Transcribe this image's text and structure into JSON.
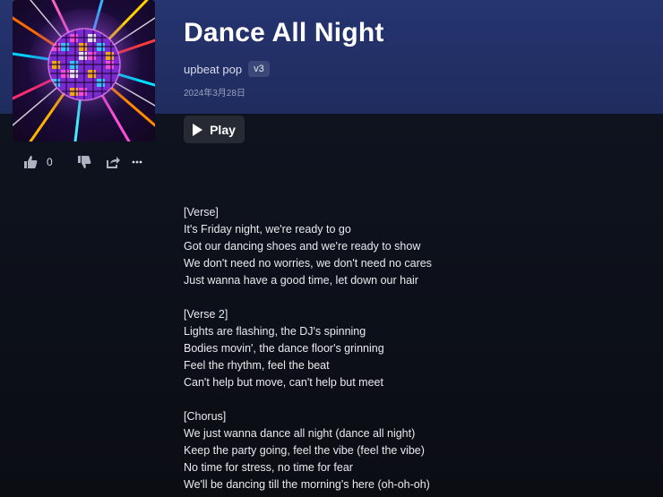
{
  "song": {
    "title": "Dance All Night",
    "tags": "upbeat pop",
    "version": "v3",
    "date": "2024年3月28日",
    "cover_icon": "disco-ball-icon"
  },
  "actions": {
    "like_count": "0",
    "like_icon": "thumbs-up-icon",
    "dislike_icon": "thumbs-down-icon",
    "share_icon": "share-icon",
    "more_icon": "more-icon"
  },
  "play_button": {
    "label": "Play",
    "icon": "play-icon"
  },
  "lyrics": {
    "stanzas": [
      [
        "[Verse]",
        "It's Friday night, we're ready to go",
        "Got our dancing shoes and we're ready to show",
        "We don't need no worries, we don't need no cares",
        "Just wanna have a good time, let down our hair"
      ],
      [
        "[Verse 2]",
        "Lights are flashing, the DJ's spinning",
        "Bodies movin', the dance floor's grinning",
        "Feel the rhythm, feel the beat",
        "Can't help but move, can't help but meet"
      ],
      [
        "[Chorus]",
        "We just wanna dance all night (dance all night)",
        "Keep the party going, feel the vibe (feel the vibe)",
        "No time for stress, no time for fear",
        "We'll be dancing till the morning's here (oh-oh-oh)"
      ]
    ]
  },
  "colors": {
    "hero_band": "#263470",
    "background": "#0c0e15",
    "play_button_bg": "#262a33",
    "version_badge_bg": "#3b4878"
  }
}
